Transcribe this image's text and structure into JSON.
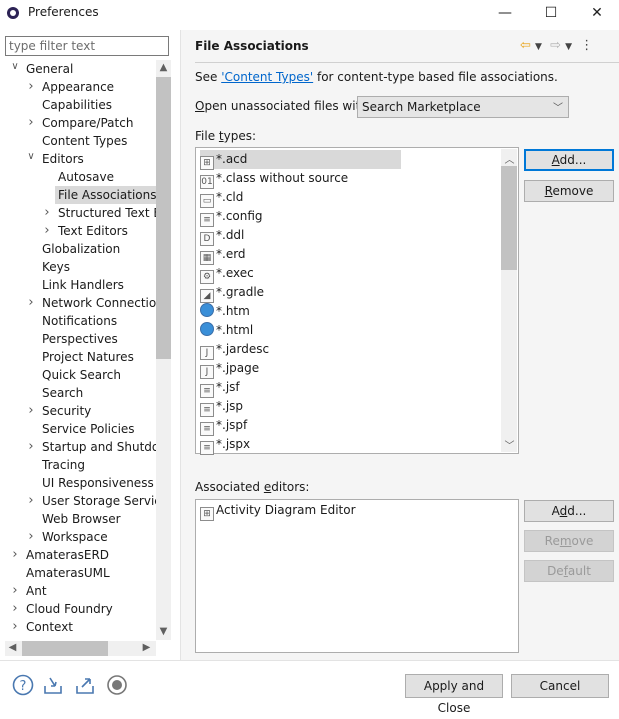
{
  "window": {
    "title": "Preferences",
    "minimize": "—",
    "maximize": "☐",
    "close": "✕"
  },
  "filter": {
    "placeholder": "type filter text",
    "value": ""
  },
  "tree": [
    {
      "label": "General",
      "level": 0,
      "state": "open"
    },
    {
      "label": "Appearance",
      "level": 1,
      "state": "closed"
    },
    {
      "label": "Capabilities",
      "level": 1,
      "state": "leaf"
    },
    {
      "label": "Compare/Patch",
      "level": 1,
      "state": "closed"
    },
    {
      "label": "Content Types",
      "level": 1,
      "state": "leaf"
    },
    {
      "label": "Editors",
      "level": 1,
      "state": "open"
    },
    {
      "label": "Autosave",
      "level": 2,
      "state": "leaf"
    },
    {
      "label": "File Associations",
      "level": 2,
      "state": "leaf",
      "selected": true
    },
    {
      "label": "Structured Text Ed",
      "level": 2,
      "state": "closed"
    },
    {
      "label": "Text Editors",
      "level": 2,
      "state": "closed"
    },
    {
      "label": "Globalization",
      "level": 1,
      "state": "leaf"
    },
    {
      "label": "Keys",
      "level": 1,
      "state": "leaf"
    },
    {
      "label": "Link Handlers",
      "level": 1,
      "state": "leaf"
    },
    {
      "label": "Network Connection",
      "level": 1,
      "state": "closed"
    },
    {
      "label": "Notifications",
      "level": 1,
      "state": "leaf"
    },
    {
      "label": "Perspectives",
      "level": 1,
      "state": "leaf"
    },
    {
      "label": "Project Natures",
      "level": 1,
      "state": "leaf"
    },
    {
      "label": "Quick Search",
      "level": 1,
      "state": "leaf"
    },
    {
      "label": "Search",
      "level": 1,
      "state": "leaf"
    },
    {
      "label": "Security",
      "level": 1,
      "state": "closed"
    },
    {
      "label": "Service Policies",
      "level": 1,
      "state": "leaf"
    },
    {
      "label": "Startup and Shutdow",
      "level": 1,
      "state": "closed"
    },
    {
      "label": "Tracing",
      "level": 1,
      "state": "leaf"
    },
    {
      "label": "UI Responsiveness M",
      "level": 1,
      "state": "leaf"
    },
    {
      "label": "User Storage Service",
      "level": 1,
      "state": "closed"
    },
    {
      "label": "Web Browser",
      "level": 1,
      "state": "leaf"
    },
    {
      "label": "Workspace",
      "level": 1,
      "state": "closed"
    },
    {
      "label": "AmaterasERD",
      "level": 0,
      "state": "closed"
    },
    {
      "label": "AmaterasUML",
      "level": 0,
      "state": "leaf"
    },
    {
      "label": "Ant",
      "level": 0,
      "state": "closed"
    },
    {
      "label": "Cloud Foundry",
      "level": 0,
      "state": "closed"
    },
    {
      "label": "Context",
      "level": 0,
      "state": "closed"
    }
  ],
  "page": {
    "title": "File Associations",
    "see_prefix": "See ",
    "see_link": "'Content Types'",
    "see_suffix": " for content-type based file associations.",
    "open_label_first": "O",
    "open_label_rest": "pen unassociated files with:",
    "open_value": "Search Marketplace",
    "file_types_label_a": "File ",
    "file_types_label_u": "t",
    "file_types_label_b": "ypes:",
    "file_types": [
      {
        "name": "*.acd",
        "icon": "diagram-icon",
        "selected": true
      },
      {
        "name": "*.class without source",
        "icon": "class-file-icon"
      },
      {
        "name": "*.cld",
        "icon": "window-icon"
      },
      {
        "name": "*.config",
        "icon": "file-icon"
      },
      {
        "name": "*.ddl",
        "icon": "ddl-icon"
      },
      {
        "name": "*.erd",
        "icon": "table-icon"
      },
      {
        "name": "*.exec",
        "icon": "gears-icon"
      },
      {
        "name": "*.gradle",
        "icon": "elephant-icon"
      },
      {
        "name": "*.htm",
        "icon": "globe-icon"
      },
      {
        "name": "*.html",
        "icon": "globe-icon"
      },
      {
        "name": "*.jardesc",
        "icon": "jar-icon"
      },
      {
        "name": "*.jpage",
        "icon": "java-icon"
      },
      {
        "name": "*.jsf",
        "icon": "file-icon"
      },
      {
        "name": "*.jsp",
        "icon": "file-icon"
      },
      {
        "name": "*.jspf",
        "icon": "file-icon"
      },
      {
        "name": "*.jspx",
        "icon": "file-icon"
      }
    ],
    "assoc_label_a": "Associated ",
    "assoc_label_u": "e",
    "assoc_label_b": "ditors:",
    "associated_editors": [
      {
        "name": "Activity Diagram Editor",
        "icon": "diagram-icon"
      }
    ],
    "buttons": {
      "add_types": "Add...",
      "remove_types": "Remove",
      "add_editor": "Add...",
      "remove_editor": "Remove",
      "default_editor": "Default"
    }
  },
  "footer": {
    "apply_close": "Apply and Close",
    "cancel": "Cancel"
  },
  "colors": {
    "accent": "#0078d7",
    "link": "#0066cc",
    "nav_arrow": "#e8a317"
  }
}
